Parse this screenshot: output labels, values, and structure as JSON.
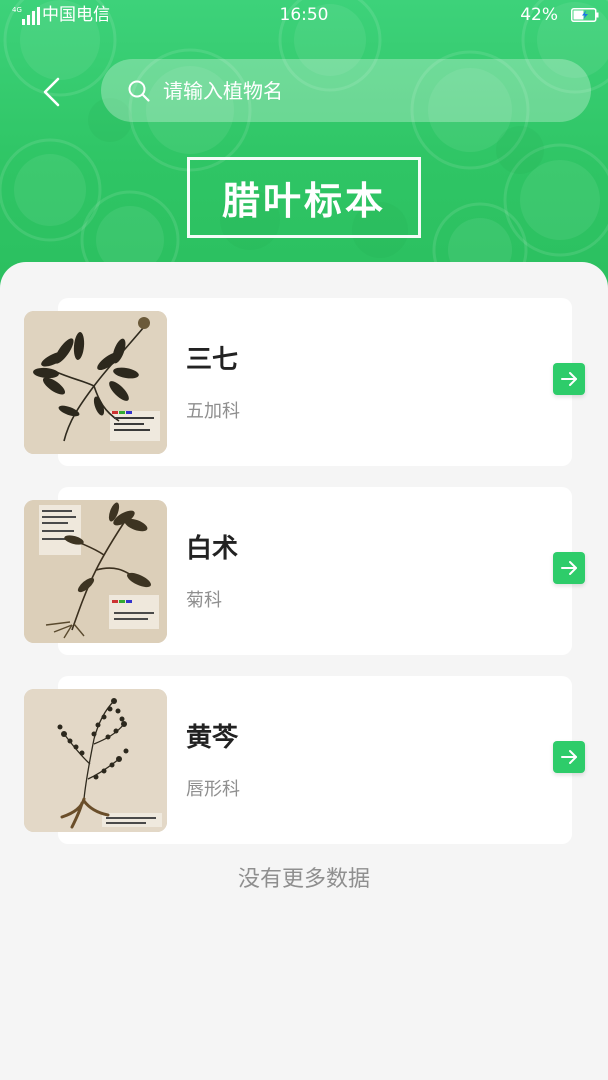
{
  "status_bar": {
    "network": "4G",
    "carrier": "中国电信",
    "time": "16:50",
    "battery": "42%"
  },
  "header": {
    "back_icon": "chevron-left-icon",
    "search_placeholder": "请输入植物名",
    "search_icon": "search-icon",
    "title": "腊叶标本",
    "accent_color": "#2ecc6a"
  },
  "plants": [
    {
      "name": "三七",
      "family": "五加科",
      "icon": "arrow-right-icon"
    },
    {
      "name": "白术",
      "family": "菊科",
      "icon": "arrow-right-icon"
    },
    {
      "name": "黄芩",
      "family": "唇形科",
      "icon": "arrow-right-icon"
    }
  ],
  "footer": {
    "no_more": "没有更多数据"
  }
}
